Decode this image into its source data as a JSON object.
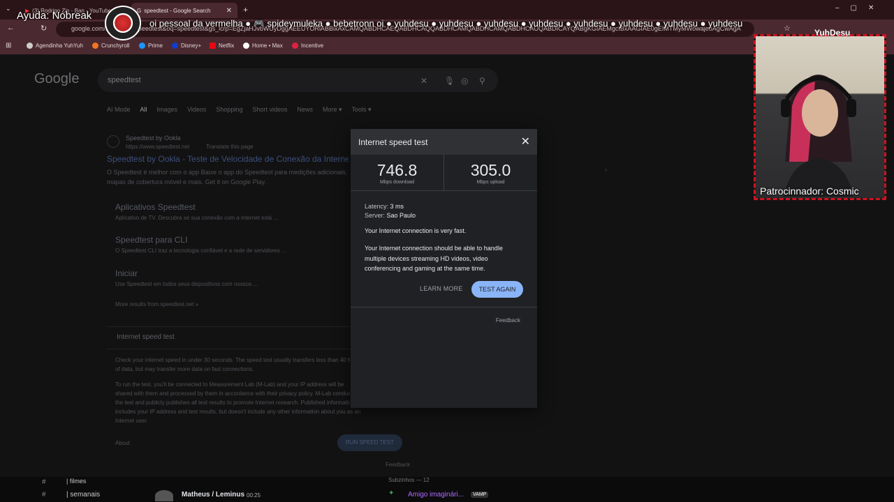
{
  "browser": {
    "tabs": [
      {
        "label": "(3) Rodrigo Zin - Ban - YouTube",
        "active": false
      },
      {
        "label": "speedtest - Google Search",
        "active": true
      }
    ],
    "new_tab": "+",
    "url": "google.com/search?q=speedtest&oq=speedtest&gs_lcrp=EgZjaHJvbWUyDggAEEUYORiABBixAxCAMQABDHCAEQABDHCAQQABDHCAMQABDHCAMQABDHCAUQABDICAYQABgKGIAEMgcIBxAAGIAE0gEIMTMyMWowajeoAgCwAgA",
    "bookmarks": [
      "Agendinha YuhYuh",
      "Crunchyroll",
      "Prime",
      "Disney+",
      "Netflix",
      "Home • Max",
      "Incentive"
    ]
  },
  "overlay": {
    "ayuda": "Ayuda: Nobreak",
    "ticker": "oi pessoal da vermelha ● 🎮 spideymuleka ● bebetronn oi ● yuhdesu ● yuhdesu ● yuhdesu ● yuhdesu ● yuhdesu ● yuhdesu ● yuhdesu ● yuhdesu",
    "cam_tag": "YuhDesu",
    "cam_label": "Patrocinnador: Cosmic"
  },
  "google": {
    "logo": "Google",
    "query": "speedtest",
    "tabs": [
      "AI Mode",
      "All",
      "Images",
      "Videos",
      "Shopping",
      "Short videos",
      "News",
      "More ▾",
      "Tools ▾"
    ],
    "result": {
      "site": "Speedtest by Ookla",
      "url": "https://www.speedtest.net",
      "translate": "Translate this page",
      "title": "Speedtest by Ookla - Teste de Velocidade de Conexão da Internet",
      "snippet1": "O Speedtest é melhor com o app Baixe o app do Speedtest para medições adicionais,",
      "snippet2": "mapas de cobertura móvel e mais. Get it on Google Play."
    },
    "sublinks": [
      {
        "title": "Aplicativos Speedtest",
        "desc": "Aplicativo de TV. Descubra se sua conexão com a internet está ..."
      },
      {
        "title": "Speedtest para CLI",
        "desc": "O Speedtest CLI traz a tecnologia confiável e a rede de servidores ..."
      },
      {
        "title": "Iniciar",
        "desc": "Use Speedtest em todos seus dispositivos com nossos ..."
      }
    ],
    "more_results": "More results from speedtest.net »",
    "card_title": "Internet speed test",
    "card_p1": "Check your internet speed in under 30 seconds. The speed test usually transfers less than 40 MB",
    "card_p1b": "of data, but may transfer more data on fast connections.",
    "card_p2": "To run the test, you'll be connected to Measurement Lab (M-Lab) and your IP address will be",
    "card_p3": "shared with them and processed by them in accordance with their privacy policy. M-Lab conducts",
    "card_p4": "the test and publicly publishes all test results to promote Internet research. Published information",
    "card_p5": "includes your IP address and test results, but doesn't include any other information about you as an",
    "card_p6": "Internet user.",
    "about": "About",
    "run_button": "RUN SPEED TEST",
    "feedback": "Feedback"
  },
  "modal": {
    "title": "Internet speed test",
    "download_value": "746.8",
    "download_unit": "Mbps download",
    "upload_value": "305.0",
    "upload_unit": "Mbps upload",
    "latency_label": "Latency:",
    "latency_value": "3 ms",
    "server_label": "Server:",
    "server_value": "Sao Paulo",
    "message_short": "Your Internet connection is very fast.",
    "message_long": "Your Internet connection should be able to handle multiple devices streaming HD videos, video conferencing and gaming at the same time.",
    "learn_more": "LEARN MORE",
    "test_again": "TEST AGAIN",
    "feedback": "Feedback",
    "accent": "#8ab4f8"
  },
  "discord": {
    "channel1": "| filmes",
    "channel2": "| semanais",
    "user": "Matheus / Leminus",
    "time": "00:25",
    "member_header": "Subzinhos — 12",
    "member": "Amigo imaginári...",
    "badge": "VAMP"
  }
}
